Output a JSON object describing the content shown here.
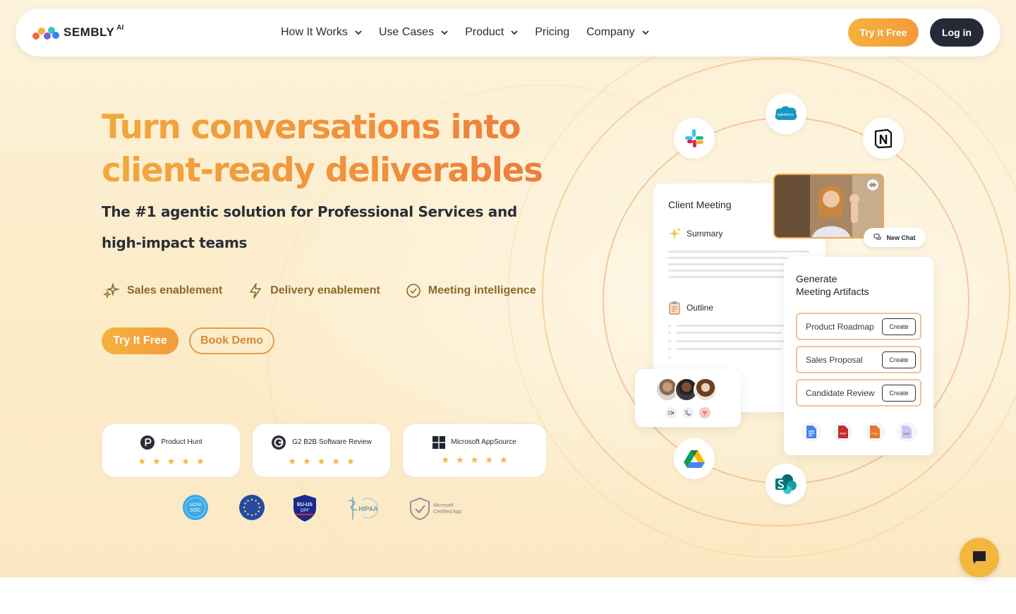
{
  "nav": {
    "logo_text": "SEMBLY",
    "logo_suffix": "AI",
    "items": [
      {
        "label": "How It Works",
        "has_dropdown": true
      },
      {
        "label": "Use Cases",
        "has_dropdown": true
      },
      {
        "label": "Product",
        "has_dropdown": true
      },
      {
        "label": "Pricing",
        "has_dropdown": false
      },
      {
        "label": "Company",
        "has_dropdown": true
      }
    ],
    "try_free": "Try it Free",
    "login": "Log in"
  },
  "hero": {
    "headline_line1": "Turn conversations into",
    "headline_line2": "client-ready deliverables",
    "subhead_line1": "The #1 agentic solution for Professional Services and",
    "subhead_line2": "high-impact teams",
    "features": [
      {
        "icon": "sparkle-icon",
        "label": "Sales enablement"
      },
      {
        "icon": "lightning-icon",
        "label": "Delivery enablement"
      },
      {
        "icon": "check-circle-icon",
        "label": "Meeting intelligence"
      }
    ],
    "cta_primary": "Try It Free",
    "cta_secondary": "Book Demo"
  },
  "reviews": [
    {
      "name": "Product Hunt",
      "icon": "product-hunt-icon",
      "stars": 5
    },
    {
      "name": "G2 B2B Software Review",
      "icon": "g2-icon",
      "stars": 5
    },
    {
      "name": "Microsoft AppSource",
      "icon": "microsoft-icon",
      "stars": 5
    }
  ],
  "badges": {
    "aicpa_line1": "AICPA",
    "aicpa_line2": "SOC",
    "eu_us_line1": "EU-US",
    "eu_us_line2": "DPF",
    "hipaa": "HIPAA",
    "ms_line1": "Microsoft",
    "ms_line2": "Certified App"
  },
  "integrations": [
    "slack-icon",
    "salesforce-icon",
    "notion-icon",
    "google-drive-icon",
    "sharepoint-icon"
  ],
  "integration_labels": {
    "salesforce": "salesforce"
  },
  "client_card": {
    "title": "Client Meeting",
    "summary_label": "Summary",
    "outline_label": "Outline"
  },
  "new_chat": "New Chat",
  "generate_card": {
    "title_line1": "Generate",
    "title_line2": "Meeting Artifacts",
    "artifacts": [
      {
        "label": "Product Roadmap",
        "action": "Create"
      },
      {
        "label": "Sales Proposal",
        "action": "Create"
      },
      {
        "label": "Candidate Review",
        "action": "Create"
      }
    ],
    "file_types": [
      "google-docs-icon",
      "pdf-icon",
      "html-icon",
      "markdown-icon"
    ],
    "file_labels": {
      "pdf": "PDF",
      "html": "HTML",
      "markdown": "MARK"
    }
  },
  "colors": {
    "accent_orange": "#f39a3b",
    "accent_yellow": "#f6b23b",
    "dark": "#252a36",
    "feature_text": "#8a6a2a"
  }
}
